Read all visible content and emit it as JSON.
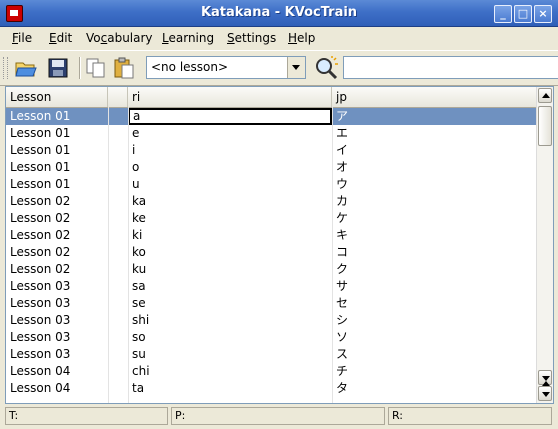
{
  "window": {
    "title": "Katakana - KVocTrain"
  },
  "menu": [
    {
      "label": "File",
      "accel": "F",
      "rest": "ile"
    },
    {
      "label": "Edit",
      "accel": "E",
      "rest": "dit"
    },
    {
      "label": "Vocabulary",
      "pre": "Vo",
      "accel": "c",
      "rest": "abulary"
    },
    {
      "label": "Learning",
      "accel": "L",
      "rest": "earning"
    },
    {
      "label": "Settings",
      "accel": "S",
      "rest": "ettings"
    },
    {
      "label": "Help",
      "accel": "H",
      "rest": "elp"
    }
  ],
  "toolbar": {
    "lesson_combo": "<no lesson>",
    "search_value": ""
  },
  "table": {
    "columns": [
      "Lesson",
      "",
      "ri",
      "jp"
    ],
    "rows": [
      {
        "lesson": "Lesson 01",
        "ri": "a",
        "jp": "ア"
      },
      {
        "lesson": "Lesson 01",
        "ri": "e",
        "jp": "エ"
      },
      {
        "lesson": "Lesson 01",
        "ri": "i",
        "jp": "イ"
      },
      {
        "lesson": "Lesson 01",
        "ri": "o",
        "jp": "オ"
      },
      {
        "lesson": "Lesson 01",
        "ri": "u",
        "jp": "ウ"
      },
      {
        "lesson": "Lesson 02",
        "ri": "ka",
        "jp": "カ"
      },
      {
        "lesson": "Lesson 02",
        "ri": "ke",
        "jp": "ケ"
      },
      {
        "lesson": "Lesson 02",
        "ri": "ki",
        "jp": "キ"
      },
      {
        "lesson": "Lesson 02",
        "ri": "ko",
        "jp": "コ"
      },
      {
        "lesson": "Lesson 02",
        "ri": "ku",
        "jp": "ク"
      },
      {
        "lesson": "Lesson 03",
        "ri": "sa",
        "jp": "サ"
      },
      {
        "lesson": "Lesson 03",
        "ri": "se",
        "jp": "セ"
      },
      {
        "lesson": "Lesson 03",
        "ri": "shi",
        "jp": "シ"
      },
      {
        "lesson": "Lesson 03",
        "ri": "so",
        "jp": "ソ"
      },
      {
        "lesson": "Lesson 03",
        "ri": "su",
        "jp": "ス"
      },
      {
        "lesson": "Lesson 04",
        "ri": "chi",
        "jp": "チ"
      },
      {
        "lesson": "Lesson 04",
        "ri": "ta",
        "jp": "タ"
      }
    ]
  },
  "status": {
    "t": "T:",
    "p": "P:",
    "r": "R:"
  }
}
